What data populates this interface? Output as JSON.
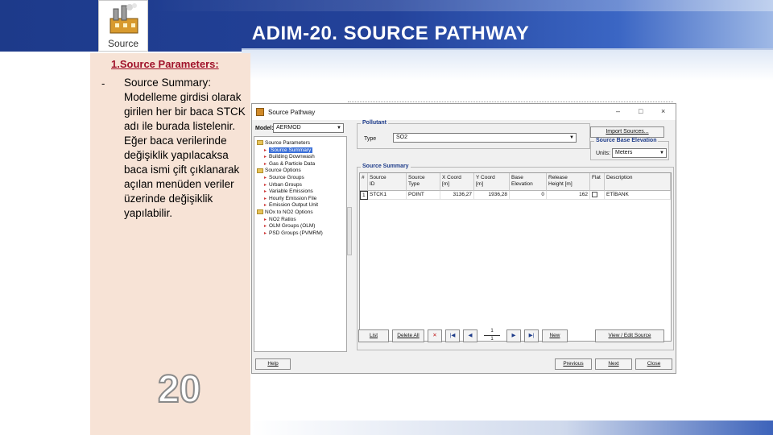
{
  "slide": {
    "title": "ADIM-20. SOURCE PATHWAY",
    "logo_label": "Source",
    "heading": "1.Source Parameters:",
    "bullet_dash": "-",
    "bullet_text": "Source Summary: Modelleme girdisi olarak girilen her bir baca STCK adı ile burada listelenir. Eğer baca verilerinde değişiklik yapılacaksa baca ismi çift çıklanarak açılan menüden veriler üzerinde değişiklik yapılabilir.",
    "slide_number": "20"
  },
  "dialog": {
    "title": "Source Pathway",
    "minimize": "–",
    "maximize": "□",
    "close": "×",
    "model_label": "Model:",
    "model_value": "AERMOD",
    "tree": [
      {
        "kind": "folder",
        "label": "Source Parameters"
      },
      {
        "kind": "leaf",
        "label": "Source Summary",
        "selected": true
      },
      {
        "kind": "leaf",
        "label": "Building Downwash"
      },
      {
        "kind": "leaf",
        "label": "Gas & Particle Data"
      },
      {
        "kind": "folder",
        "label": "Source Options"
      },
      {
        "kind": "leaf",
        "label": "Source Groups"
      },
      {
        "kind": "leaf",
        "label": "Urban Groups"
      },
      {
        "kind": "leaf",
        "label": "Variable Emissions"
      },
      {
        "kind": "leaf",
        "label": "Hourly Emission File"
      },
      {
        "kind": "leaf",
        "label": "Emission Output Unit"
      },
      {
        "kind": "folder",
        "label": "NOx to NO2 Options"
      },
      {
        "kind": "leaf",
        "label": "NO2 Ratios"
      },
      {
        "kind": "leaf",
        "label": "OLM Groups (OLM)"
      },
      {
        "kind": "leaf",
        "label": "PSD Groups (PVMRM)"
      }
    ],
    "pollutant": {
      "group_title": "Pollutant",
      "type_label": "Type",
      "type_value": "SO2"
    },
    "import_button": "Import Sources...",
    "elevation": {
      "group_title": "Source Base Elevation",
      "units_label": "Units:",
      "units_value": "Meters"
    },
    "summary": {
      "group_title": "Source Summary",
      "columns": [
        "#",
        "Source\nID",
        "Source\nType",
        "X Coord\n[m]",
        "Y Coord\n[m]",
        "Base\nElevation",
        "Release\nHeight [m]",
        "Flat",
        "Description"
      ],
      "rows": [
        {
          "num": "1",
          "id": "STCK1",
          "type": "POINT",
          "x": "3136,27",
          "y": "1936,28",
          "elev": "0",
          "height": "162",
          "flat": "",
          "desc": "ETİBANK"
        }
      ]
    },
    "nav": {
      "list": "List",
      "delete_all": "Delete All",
      "delete_icon": "✕",
      "first_icon": "|◀",
      "prev_icon": "◀",
      "counter_top": "1",
      "counter_bottom": "1",
      "next_icon": "▶",
      "last_icon": "▶|",
      "new": "New",
      "view_edit": "View / Edit Source"
    },
    "footer": {
      "help": "Help",
      "previous": "Previous",
      "next": "Next",
      "close": "Close"
    }
  }
}
